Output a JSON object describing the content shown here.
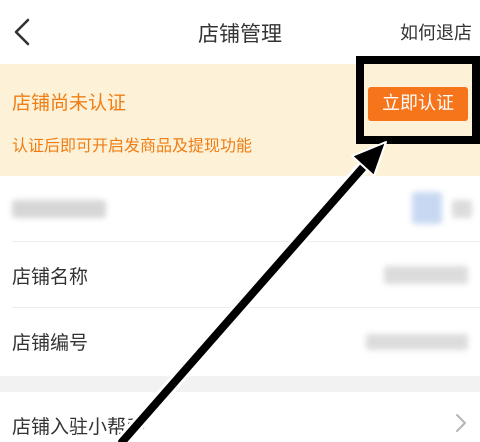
{
  "header": {
    "title": "店铺管理",
    "right_link": "如何退店"
  },
  "banner": {
    "title": "店铺尚未认证",
    "subtitle": "认证后即可开启发商品及提现功能",
    "button_label": "立即认证"
  },
  "info_rows": [
    {
      "label": ""
    },
    {
      "label": "店铺名称"
    },
    {
      "label": "店铺编号"
    }
  ],
  "helper": {
    "label": "店铺入驻小帮手"
  },
  "colors": {
    "accent": "#f6741a",
    "banner_bg": "#fdf2d8",
    "banner_text": "#ef7d14"
  },
  "icons": {
    "back": "chevron-left-icon",
    "helper_arrow": "chevron-right-icon"
  }
}
